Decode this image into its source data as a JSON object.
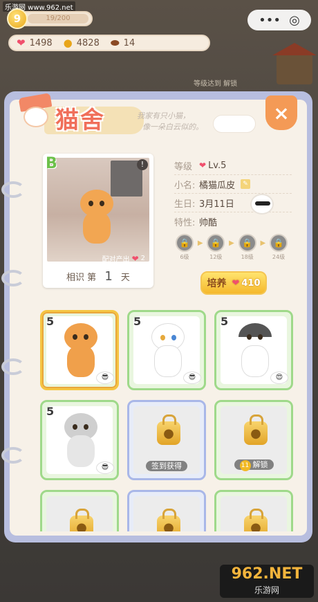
{
  "watermark_top": "乐游网 www.962.net",
  "top_bar": {
    "level": "9",
    "exp": "19/200",
    "more_icon": "ellipsis-icon",
    "target_icon": "target-icon"
  },
  "currencies": [
    {
      "icon": "heart-icon",
      "value": "1498"
    },
    {
      "icon": "coin-icon",
      "value": "4828"
    },
    {
      "icon": "bean-icon",
      "value": "14"
    }
  ],
  "background": {
    "unlock_label": "等级达到   解锁"
  },
  "title": "猫舍",
  "subtitle_line1": "我家有只小猫，",
  "subtitle_line2": "像一朵白云似的。",
  "close_label": "×",
  "profile": {
    "grade": "B",
    "info_icon": "!",
    "pair_output_label": "配对产出",
    "pair_output_value": "2",
    "days_prefix": "相识 第",
    "days_value": "1",
    "days_suffix": "天",
    "level_key": "等级",
    "level_value": "Lv.5",
    "name_key": "小名:",
    "name_value": "橘猫瓜皮",
    "birthday_key": "生日:",
    "birthday_value": "3月11日",
    "trait_key": "特性:",
    "trait_value": "帅酷"
  },
  "milestones": [
    {
      "label": "6级"
    },
    {
      "label": "12级"
    },
    {
      "label": "18级"
    },
    {
      "label": "24级"
    }
  ],
  "cultivate": {
    "label": "培养",
    "cost": "410"
  },
  "slots": [
    {
      "level": "5",
      "type": "cat",
      "color": "#f0a04b",
      "selected": true
    },
    {
      "level": "5",
      "type": "cat",
      "color": "#ffffff"
    },
    {
      "level": "5",
      "type": "cat",
      "color": "#ffffff"
    },
    {
      "level": "5",
      "type": "cat",
      "color": "#c9c9c9"
    },
    {
      "type": "locked",
      "caption": "签到获得"
    },
    {
      "type": "locked",
      "caption": "解锁",
      "caption_level": "11"
    }
  ],
  "watermark_bottom": {
    "big": "962.NET",
    "small": "乐游网"
  }
}
